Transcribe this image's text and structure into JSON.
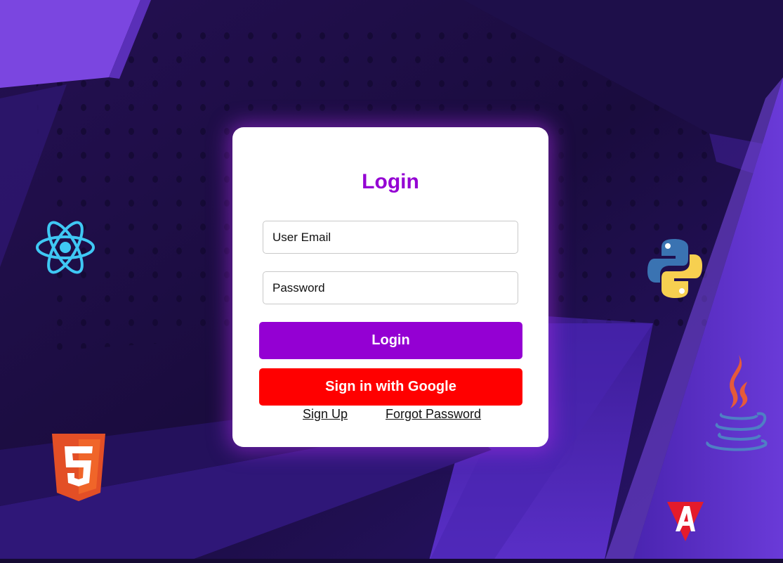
{
  "login_card": {
    "title": "Login",
    "email_placeholder": "User Email",
    "password_placeholder": "Password",
    "login_button": "Login",
    "google_button": "Sign in with Google",
    "signup_link": "Sign Up",
    "forgot_link": "Forgot Password"
  },
  "background_icons": [
    "react-icon",
    "python-icon",
    "java-icon",
    "html5-icon",
    "angular-icon"
  ],
  "colors": {
    "title": "#9400d3",
    "login_button": "#9400d3",
    "google_button": "#ff0000",
    "background": "#1c0f45",
    "card_glow": "#a82ce6"
  }
}
